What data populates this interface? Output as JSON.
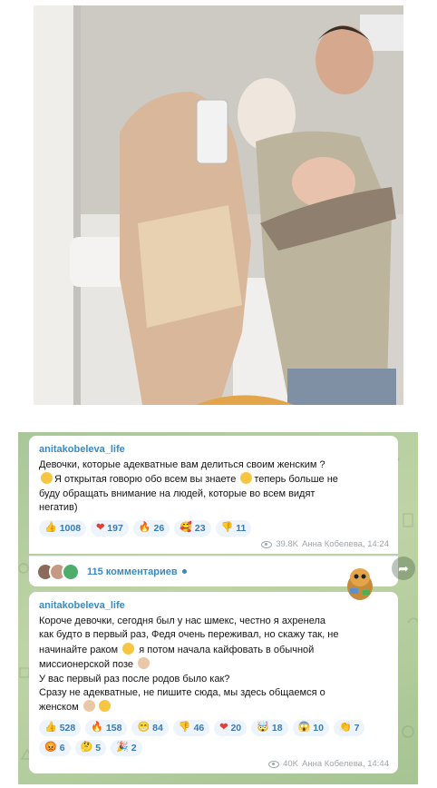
{
  "photo": {
    "alt": "",
    "sticker": "gopher-sticker"
  },
  "post1": {
    "channel": "anitakobeleva_life",
    "lines": [
      "Девочки, которые адекватные вам делиться своим женским ?",
      "Я открытая говорю обо всем вы знаете",
      "теперь больше не",
      "буду обращать внимание на людей, которые во всем видят",
      "негатив)"
    ],
    "reactions": [
      {
        "icon": "👍",
        "count": "1008"
      },
      {
        "icon": "❤",
        "count": "197"
      },
      {
        "icon": "🔥",
        "count": "26"
      },
      {
        "icon": "🥰",
        "count": "23"
      },
      {
        "icon": "👎",
        "count": "11"
      }
    ],
    "views": "39.8K",
    "author_time": "Анна Кобелева, 14:24"
  },
  "comments": {
    "label": "115 комментариев"
  },
  "post2": {
    "channel": "anitakobeleva_life",
    "lines": [
      "Короче девочки, сегодня был у нас шмекс, честно я ахренела",
      "как будто в первый раз, Федя очень переживал, но скажу так, не",
      "начинайте раком",
      "я потом начала кайфовать в обычной",
      "миссионерской позе",
      "У вас первый раз после родов было как?",
      "Сразу не адекватные, не пишите сюда, мы здесь общаемся о",
      "женском"
    ],
    "reactions": [
      {
        "icon": "👍",
        "count": "528"
      },
      {
        "icon": "🔥",
        "count": "158"
      },
      {
        "icon": "😁",
        "count": "84"
      },
      {
        "icon": "👎",
        "count": "46"
      },
      {
        "icon": "❤",
        "count": "20"
      },
      {
        "icon": "🤯",
        "count": "18"
      },
      {
        "icon": "😱",
        "count": "10"
      },
      {
        "icon": "👏",
        "count": "7"
      },
      {
        "icon": "😡",
        "count": "6"
      },
      {
        "icon": "🤔",
        "count": "5"
      },
      {
        "icon": "🎉",
        "count": "2"
      }
    ],
    "views": "40K",
    "author_time": "Анна Кобелева, 14:44"
  },
  "share": {
    "icon": "share-arrow-icon"
  }
}
